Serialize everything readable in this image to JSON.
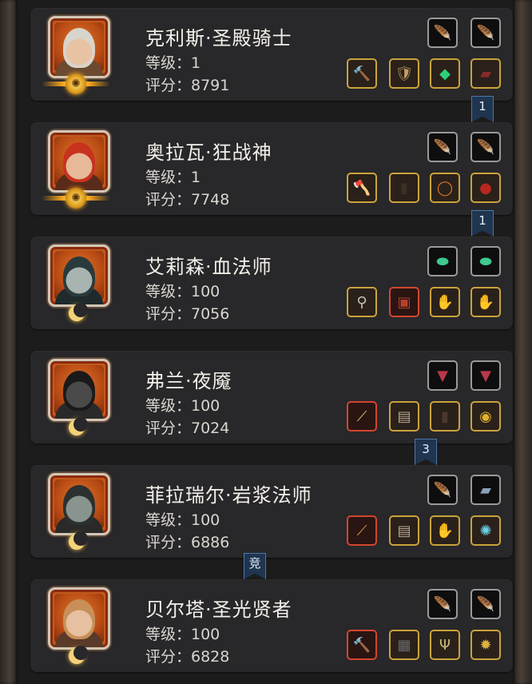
{
  "heroes": [
    {
      "name": "克利斯·圣殿骑士",
      "level_label": "等级：1",
      "score_label": "评分：8791",
      "badge": "sun-emblem",
      "portrait": {
        "hair": "#d8d4cc",
        "skin": "#e8c3a3",
        "body": "#6b4a30"
      },
      "top_slots": [
        {
          "icon": "feather-icon",
          "glyph": "🪶",
          "rarity": "grey",
          "color": "#dcdcdc"
        },
        {
          "icon": "feather-icon",
          "glyph": "🪶",
          "rarity": "grey",
          "color": "#dcdcdc"
        }
      ],
      "bottom_slots": [
        {
          "icon": "hammer-icon",
          "glyph": "🔨",
          "rarity": "gold",
          "color": "#c9b49a"
        },
        {
          "icon": "armor-icon",
          "glyph": "🛡",
          "rarity": "gold",
          "color": "#c29a62"
        },
        {
          "icon": "emerald-icon",
          "glyph": "◆",
          "rarity": "gold",
          "color": "#2fcf78"
        },
        {
          "icon": "boots-icon",
          "glyph": "▰",
          "rarity": "gold",
          "color": "#8b2a2a"
        }
      ],
      "bookmark": "1"
    },
    {
      "name": "奥拉瓦·狂战神",
      "level_label": "等级：1",
      "score_label": "评分：7748",
      "badge": "sun-emblem",
      "portrait": {
        "hair": "#c8321e",
        "skin": "#e6b998",
        "body": "#5a2a1a"
      },
      "top_slots": [
        {
          "icon": "feather-icon",
          "glyph": "🪶",
          "rarity": "grey",
          "color": "#9a8f88"
        },
        {
          "icon": "feather-icon",
          "glyph": "🪶",
          "rarity": "grey",
          "color": "#9a8f88"
        }
      ],
      "bottom_slots": [
        {
          "icon": "axe-icon",
          "glyph": "🪓",
          "rarity": "gold",
          "color": "#d8d0c0"
        },
        {
          "icon": "robe-icon",
          "glyph": "▮",
          "rarity": "gold",
          "color": "#3a3024"
        },
        {
          "icon": "ring-icon",
          "glyph": "◯",
          "rarity": "gold",
          "color": "#e07a2a"
        },
        {
          "icon": "amulet-icon",
          "glyph": "●",
          "rarity": "gold",
          "color": "#b8281e"
        }
      ],
      "bookmark": "1"
    },
    {
      "name": "艾莉森·血法师",
      "level_label": "等级：100",
      "score_label": "评分：7056",
      "badge": "moon-emblem",
      "portrait": {
        "hair": "#2a3a3c",
        "skin": "#a8b4b0",
        "body": "#1e2a2c"
      },
      "top_slots": [
        {
          "icon": "jade-icon",
          "glyph": "⬬",
          "rarity": "grey",
          "color": "#3ec98e"
        },
        {
          "icon": "jade-icon",
          "glyph": "⬬",
          "rarity": "grey",
          "color": "#3ec98e"
        }
      ],
      "bottom_slots": [
        {
          "icon": "staff-icon",
          "glyph": "⚲",
          "rarity": "gold",
          "color": "#c8c2b4"
        },
        {
          "icon": "chest-armor-icon",
          "glyph": "▣",
          "rarity": "red",
          "color": "#b8402a"
        },
        {
          "icon": "gauntlet-icon",
          "glyph": "✋",
          "rarity": "gold",
          "color": "#c8a090"
        },
        {
          "icon": "gauntlet-icon",
          "glyph": "✋",
          "rarity": "gold",
          "color": "#c8a090"
        }
      ],
      "bookmark": ""
    },
    {
      "name": "弗兰·夜魇",
      "level_label": "等级：100",
      "score_label": "评分：7024",
      "badge": "moon-emblem",
      "portrait": {
        "hair": "#1a1a1a",
        "skin": "#4a4a4a",
        "body": "#2a2a2a"
      },
      "top_slots": [
        {
          "icon": "bracer-icon",
          "glyph": "▼",
          "rarity": "grey",
          "color": "#b8384a"
        },
        {
          "icon": "bracer-icon",
          "glyph": "▼",
          "rarity": "grey",
          "color": "#b8384a"
        }
      ],
      "bottom_slots": [
        {
          "icon": "dagger-icon",
          "glyph": "⟋",
          "rarity": "red",
          "color": "#e0c060"
        },
        {
          "icon": "vest-icon",
          "glyph": "▤",
          "rarity": "gold",
          "color": "#b8a890"
        },
        {
          "icon": "cloak-icon",
          "glyph": "▮",
          "rarity": "gold",
          "color": "#4a3830"
        },
        {
          "icon": "gold-ring-icon",
          "glyph": "◉",
          "rarity": "gold",
          "color": "#e0b030"
        }
      ],
      "bookmark": "3"
    },
    {
      "name": "菲拉瑞尔·岩浆法师",
      "level_label": "等级：100",
      "score_label": "评分：6886",
      "badge": "moon-emblem",
      "portrait": {
        "hair": "#2c3030",
        "skin": "#8a948e",
        "body": "#2a2a28"
      },
      "top_slots": [
        {
          "icon": "feather-icon",
          "glyph": "🪶",
          "rarity": "grey",
          "color": "#8a8a8a"
        },
        {
          "icon": "tome-icon",
          "glyph": "▰",
          "rarity": "grey",
          "color": "#8aa0b8"
        }
      ],
      "bottom_slots": [
        {
          "icon": "wand-icon",
          "glyph": "⟋",
          "rarity": "red",
          "color": "#e0a040"
        },
        {
          "icon": "vest-icon",
          "glyph": "▤",
          "rarity": "gold",
          "color": "#b8a890"
        },
        {
          "icon": "gauntlet-icon",
          "glyph": "✋",
          "rarity": "gold",
          "color": "#c8a090"
        },
        {
          "icon": "crystal-orb-icon",
          "glyph": "✺",
          "rarity": "gold",
          "color": "#6ad0e8"
        }
      ],
      "bookmark": "竞"
    },
    {
      "name": "贝尔塔·圣光贤者",
      "level_label": "等级：100",
      "score_label": "评分：6828",
      "badge": "moon-emblem",
      "portrait": {
        "hair": "#c89058",
        "skin": "#e6c0a0",
        "body": "#5a3a28"
      },
      "top_slots": [
        {
          "icon": "feather-icon",
          "glyph": "🪶",
          "rarity": "grey",
          "color": "#dcdcdc"
        },
        {
          "icon": "feather-icon",
          "glyph": "🪶",
          "rarity": "grey",
          "color": "#dcdcdc"
        }
      ],
      "bottom_slots": [
        {
          "icon": "hammer-icon",
          "glyph": "🔨",
          "rarity": "red",
          "color": "#e8d090"
        },
        {
          "icon": "armor-icon",
          "glyph": "▦",
          "rarity": "gold",
          "color": "#6a6a70"
        },
        {
          "icon": "trident-icon",
          "glyph": "Ψ",
          "rarity": "gold",
          "color": "#c8b878"
        },
        {
          "icon": "medallion-icon",
          "glyph": "✹",
          "rarity": "gold",
          "color": "#e0b040"
        }
      ],
      "bookmark": ""
    }
  ]
}
